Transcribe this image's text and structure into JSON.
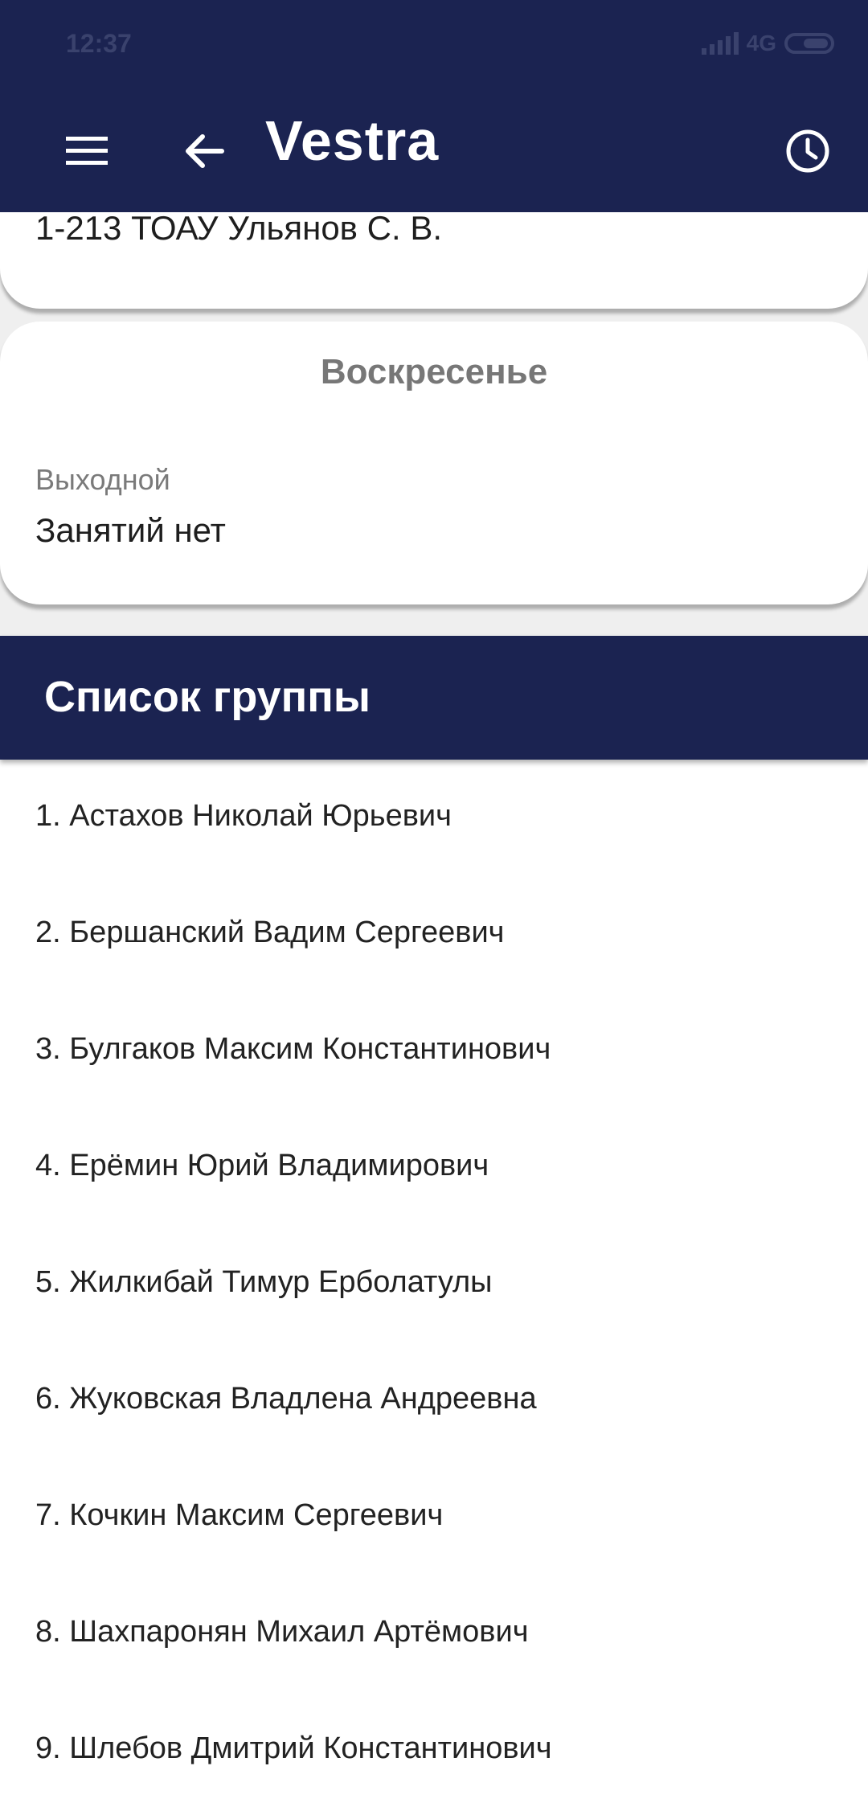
{
  "status_bar": {
    "time": "12:37",
    "network": "4G"
  },
  "appbar": {
    "title": "Vestra",
    "icons": [
      "menu-icon",
      "arrow-left-icon",
      "clock-icon"
    ]
  },
  "previous_card": {
    "lesson": "1-213 ТОАУ Ульянов С. В."
  },
  "sunday_card": {
    "day": "Воскресенье",
    "label": "Выходной",
    "text": "Занятий нет"
  },
  "group": {
    "title": "Список группы",
    "members": [
      "1. Астахов Николай Юрьевич",
      "2. Бершанский Вадим Сергеевич",
      "3. Булгаков Максим Константинович",
      "4. Ерёмин Юрий Владимирович",
      "5. Жилкибай Тимур Ерболатулы",
      "6. Жуковская Владлена Андреевна",
      "7. Кочкин Максим Сергеевич",
      "8. Шахпаронян Михаил Артёмович",
      "9. Шлебов Дмитрий Константинович"
    ]
  },
  "colors": {
    "primary": "#1b2351",
    "background": "#efefef",
    "card": "#ffffff"
  }
}
